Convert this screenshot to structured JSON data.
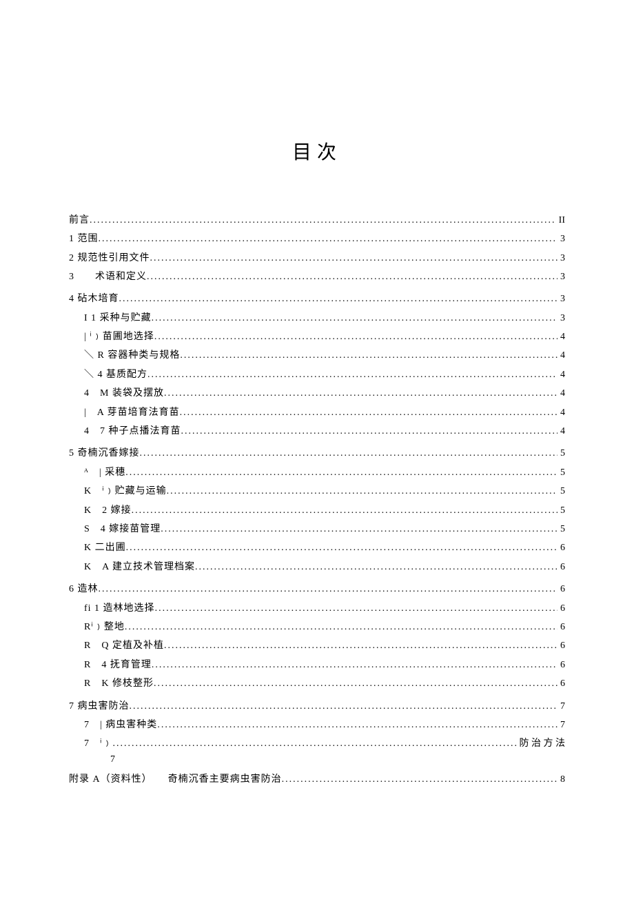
{
  "title": "目次",
  "entries": [
    {
      "level": 0,
      "label": "前言",
      "page": "II",
      "gap": false
    },
    {
      "level": 0,
      "label": "1 范围",
      "page": "3",
      "gap": false
    },
    {
      "level": 0,
      "label": "2 规范性引用文件",
      "page": "3",
      "gap": false
    },
    {
      "level": 0,
      "label": "3　　术语和定义",
      "page": "3",
      "gap": false
    },
    {
      "level": 0,
      "label": "4 砧木培育",
      "page": "3",
      "gap": true
    },
    {
      "level": 1,
      "label": "I 1 采种与贮藏",
      "page": "3",
      "gap": false
    },
    {
      "level": 1,
      "label": "| ⁱ﹚苗圃地选择",
      "page": "4",
      "gap": false
    },
    {
      "level": 1,
      "label": "＼ R 容器种类与规格",
      "page": "4",
      "gap": false
    },
    {
      "level": 1,
      "label": "＼ 4 基质配方",
      "page": "4",
      "gap": false
    },
    {
      "level": 1,
      "label": "4　M 装袋及摆放",
      "page": "4",
      "gap": false
    },
    {
      "level": 1,
      "label": "|　A 芽苗培育法育苗",
      "page": "4",
      "gap": false
    },
    {
      "level": 1,
      "label": "4　7 种子点播法育苗",
      "page": "4",
      "gap": false
    },
    {
      "level": 0,
      "label": "5 奇楠沉香嫁接",
      "page": "5",
      "gap": true
    },
    {
      "level": 1,
      "label": "ᴬ　| 采穗",
      "page": "5",
      "gap": false
    },
    {
      "level": 1,
      "label": "K　ⁱ﹚贮藏与运输",
      "page": "5",
      "gap": false
    },
    {
      "level": 1,
      "label": "K　2 嫁接",
      "page": "5",
      "gap": false
    },
    {
      "level": 1,
      "label": "S　4 嫁接苗管理",
      "page": "5",
      "gap": false
    },
    {
      "level": 1,
      "label": "K 二出圃",
      "page": "6",
      "gap": false
    },
    {
      "level": 1,
      "label": "K　A 建立技术管理档案",
      "page": "6",
      "gap": false
    },
    {
      "level": 0,
      "label": "6 造林",
      "page": "6",
      "gap": true
    },
    {
      "level": 1,
      "label": "fi 1 造林地选择",
      "page": "6",
      "gap": false
    },
    {
      "level": 1,
      "label": "Rⁱ﹚整地",
      "page": "6",
      "gap": false
    },
    {
      "level": 1,
      "label": "R　Q 定植及补植",
      "page": "6",
      "gap": false
    },
    {
      "level": 1,
      "label": "R　4 抚育管理",
      "page": "6",
      "gap": false
    },
    {
      "level": 1,
      "label": "R　K 修枝整形",
      "page": "6",
      "gap": false
    },
    {
      "level": 0,
      "label": "7 病虫害防治",
      "page": "7",
      "gap": true
    },
    {
      "level": 1,
      "label": "7　| 病虫害种类",
      "page": "7",
      "gap": false
    },
    {
      "level": 1,
      "label": "7　ⁱ﹚",
      "page": "防 治 方 法",
      "gap": false,
      "pagebreak_below": "7"
    },
    {
      "level": 0,
      "label": "附录 A（资料性）　　奇楠沉香主要病虫害防治",
      "page": "8",
      "gap": true
    }
  ]
}
